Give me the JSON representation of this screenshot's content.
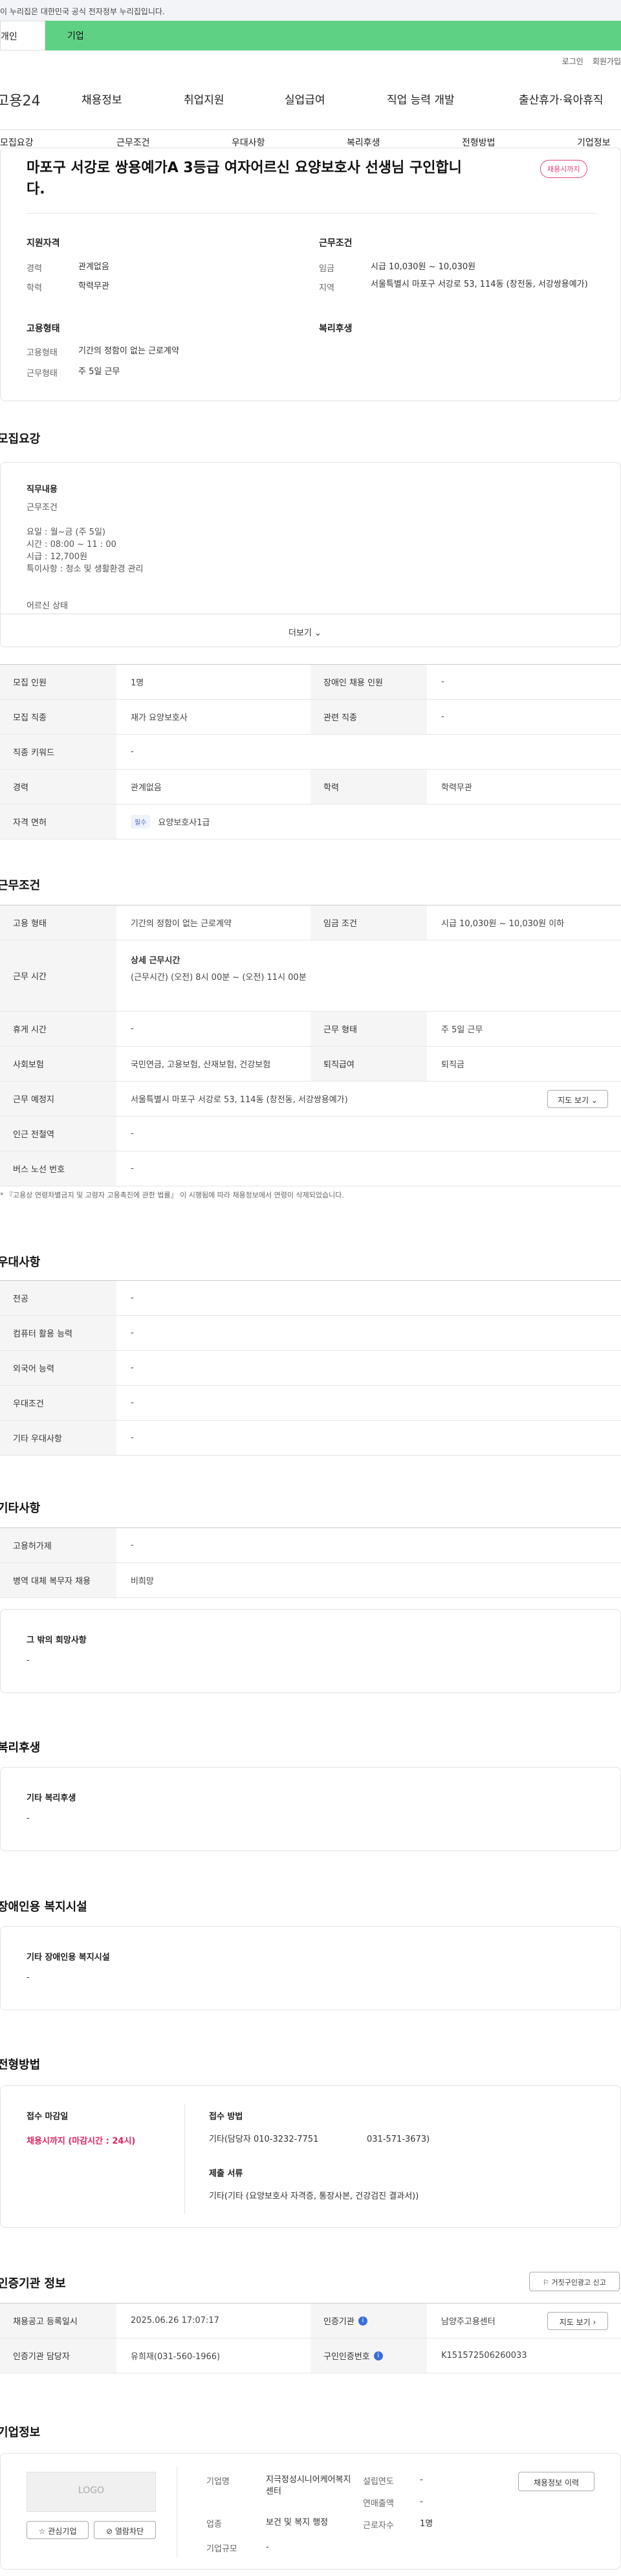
{
  "gov_banner": "이 누리집은 대한민국 공식 전자정부 누리집입니다.",
  "top_tabs": {
    "personal": "개인",
    "company": "기업"
  },
  "util": {
    "login": "로그인",
    "join": "회원가입"
  },
  "brand": "고용24",
  "gnb": [
    "채용정보",
    "취업지원",
    "실업급여",
    "직업 능력 개발",
    "출산휴가·육아휴직"
  ],
  "subnav": [
    "모집요강",
    "근무조건",
    "우대사항",
    "복리후생",
    "전형방법",
    "기업정보"
  ],
  "summary": {
    "title": "마포구 서강로 쌍용예가A 3등급 여자어르신 요양보호사 선생님 구인합니다.",
    "badge": "채용시까지",
    "qual_heading": "지원자격",
    "career_label": "경력",
    "career": "관계없음",
    "edu_label": "학력",
    "edu": "학력무관",
    "emp_heading": "고용형태",
    "type_label": "고용형태",
    "type": "기간의 정함이 없는 근로계약",
    "form_label": "근무형태",
    "form": "주 5일 근무",
    "cond_heading": "근무조건",
    "wage_label": "임금",
    "wage": "시급 10,030원 ~ 10,030원",
    "region_label": "지역",
    "region": "서울특별시 마포구 서강로 53, 114동 (창전동, 서강쌍용예가)",
    "welfare_heading": "복리후생"
  },
  "recruit": {
    "heading": "모집요강",
    "duty_heading": "직무내용",
    "lines": [
      "근무조건",
      "",
      "요일 : 월~금  (주 5일)",
      "시간 : 08:00 ~ 11 : 00",
      "시급 : 12,700원",
      "특이사항 : 청소 및 생활환경 관리",
      "",
      "",
      "어르신 상태"
    ],
    "more": "더보기",
    "rows": [
      {
        "l1": "모집 인원",
        "v1": "1명",
        "l2": "장애인 채용 인원",
        "v2": "-"
      },
      {
        "l1": "모집 직종",
        "v1": "재가 요양보호사",
        "l2": "관련 직종",
        "v2": "-"
      },
      {
        "l1": "직종 키워드",
        "v1": "-"
      },
      {
        "l1": "경력",
        "v1": "관계없음",
        "l2": "학력",
        "v2": "학력무관"
      },
      {
        "l1": "자격 면허",
        "tag": "필수",
        "v1": "요양보호사1급"
      }
    ]
  },
  "work": {
    "heading": "근무조건",
    "type_l": "고용 형태",
    "type_v": "기간의 정함이 없는 근로계약",
    "wage_l": "임금 조건",
    "wage_v": "시급 10,030원 ~ 10,030원 이하",
    "time_l": "근무 시간",
    "time_t": "상세 근무시간",
    "time_v": "(근무시간) (오전) 8시 00분 ~ (오전) 11시 00분",
    "rest_l": "휴게 시간",
    "rest_v": "-",
    "form_l": "근무 형태",
    "form_v": "주 5일 근무",
    "ins_l": "사회보험",
    "ins_v": "국민연금, 고용보험, 산재보험, 건강보험",
    "sev_l": "퇴직급여",
    "sev_v": "퇴직금",
    "place_l": "근무 예정지",
    "place_v": "서울특별시 마포구 서강로 53, 114동 (창전동, 서강쌍용예가)",
    "map_btn": "지도 보기",
    "sub_l": "인근 전철역",
    "sub_v": "-",
    "bus_l": "버스 노선 번호",
    "bus_v": "-",
    "note": "* 『고용상 연령차별금지 및 고령자 고용촉진에 관한 법률』 이 시행됨에 따라 채용정보에서 연령이 삭제되었습니다."
  },
  "pref": {
    "heading": "우대사항",
    "rows": [
      {
        "l": "전공",
        "v": "-"
      },
      {
        "l": "컴퓨터 활용 능력",
        "v": "-"
      },
      {
        "l": "외국어 능력",
        "v": "-"
      },
      {
        "l": "우대조건",
        "v": "-"
      },
      {
        "l": "기타 우대사항",
        "v": "-"
      }
    ]
  },
  "etc": {
    "heading": "기타사항",
    "rows": [
      {
        "l": "고용허가제",
        "v": "-"
      },
      {
        "l": "병역 대체 복무자 채용",
        "v": "비희망"
      }
    ],
    "hope_t": "그 밖의 희망사항",
    "hope_v": "-"
  },
  "welfare": {
    "heading": "복리후생",
    "t": "기타 복리후생",
    "v": "-"
  },
  "disab": {
    "heading": "장애인용 복지시설",
    "t": "기타 장애인용 복지시설",
    "v": "-"
  },
  "process": {
    "heading": "전형방법",
    "deadline_t": "접수 마감일",
    "deadline_v": "채용시까지 (마감시간 : 24시)",
    "method_t": "접수 방법",
    "method_v": "기타(담당자 010-3232-7751",
    "method_v2": "031-571-3673)",
    "docs_t": "제출 서류",
    "docs_v": "기타(기타 (요양보호사 자격증, 통장사본, 건강검진 결과서))"
  },
  "auth": {
    "heading": "인증기관 정보",
    "report": "거짓구인광고 신고",
    "reg_l": "채용공고 등록일시",
    "reg_v": "2025.06.26 17:07:17",
    "org_l": "인증기관",
    "org_v": "남양주고용센터",
    "map_btn": "지도 보기",
    "mgr_l": "인증기관 담당자",
    "mgr_v": "유희재(031-560-1966)",
    "no_l": "구인인증번호",
    "no_v": "K151572506260033"
  },
  "company": {
    "heading": "기업정보",
    "logo": "LOGO",
    "fav": "관심기업",
    "block": "열람차단",
    "history": "채용정보 이력",
    "name_l": "기업명",
    "name_v": "지극정성시니어케어복지센터",
    "ind_l": "업종",
    "ind_v": "보건 및 복지 행정",
    "size_l": "기업규모",
    "size_v": "-",
    "year_l": "설립연도",
    "year_v": "-",
    "rev_l": "연매출액",
    "rev_v": "-",
    "emp_l": "근로자수",
    "emp_v": "1명"
  }
}
